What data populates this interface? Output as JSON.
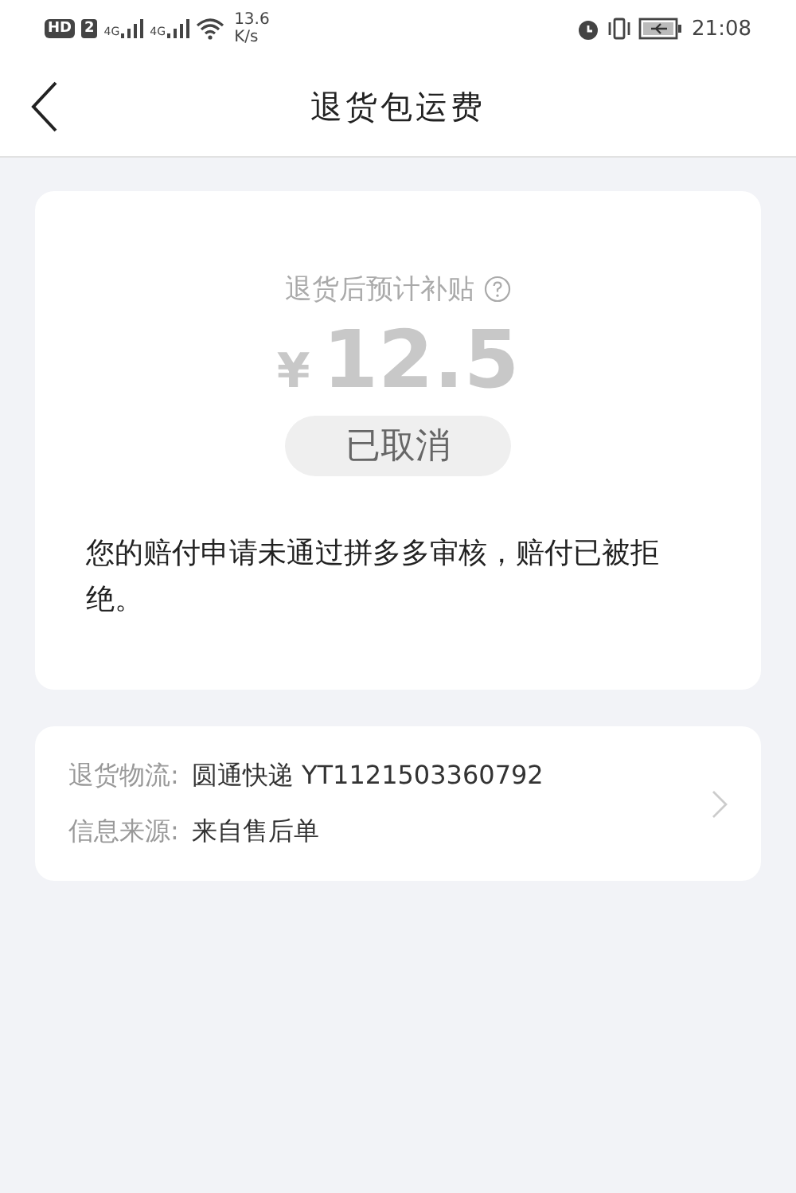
{
  "status_bar": {
    "hd": "HD",
    "sim": "2",
    "network_1": "4G",
    "network_2": "4G",
    "speed_value": "13.6",
    "speed_unit": "K/s",
    "time": "21:08"
  },
  "nav_bar": {
    "title": "退货包运费"
  },
  "subsidy_card": {
    "label": "退货后预计补贴",
    "currency": "¥",
    "amount": "12.5",
    "status": "已取消",
    "message": "您的赔付申请未通过拼多多审核，赔付已被拒绝。"
  },
  "info_card": {
    "rows": [
      {
        "label": "退货物流:",
        "value": "圆通快递 YT1121503360792"
      },
      {
        "label": "信息来源:",
        "value": "来自售后单"
      }
    ]
  }
}
